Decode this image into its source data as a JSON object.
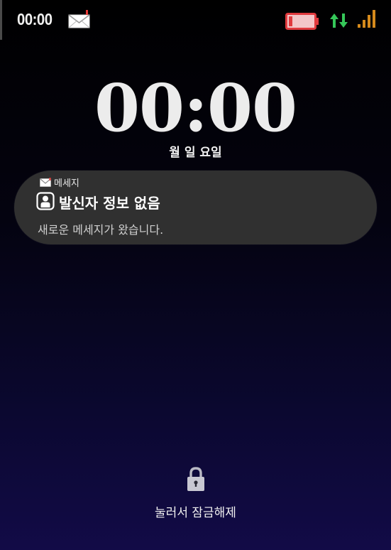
{
  "status_bar": {
    "time": "00:00",
    "mail_icon": "envelope-icon",
    "battery_icon": "battery-low-icon",
    "data_icon": "data-arrows-icon",
    "signal_icon": "signal-bars-icon",
    "battery_color": "#e03a3e",
    "data_color": "#35c759",
    "signal_color": "#d58a1c"
  },
  "lock_screen": {
    "clock": "00:00",
    "date": "월 일 요일"
  },
  "notification": {
    "app_icon": "envelope-icon",
    "app_name": "메세지",
    "avatar_icon": "person-contact-icon",
    "title": "발신자 정보 없음",
    "body": "새로운 메세지가 왔습니다."
  },
  "unlock": {
    "icon": "lock-icon",
    "hint": "눌러서 잠금해제"
  }
}
